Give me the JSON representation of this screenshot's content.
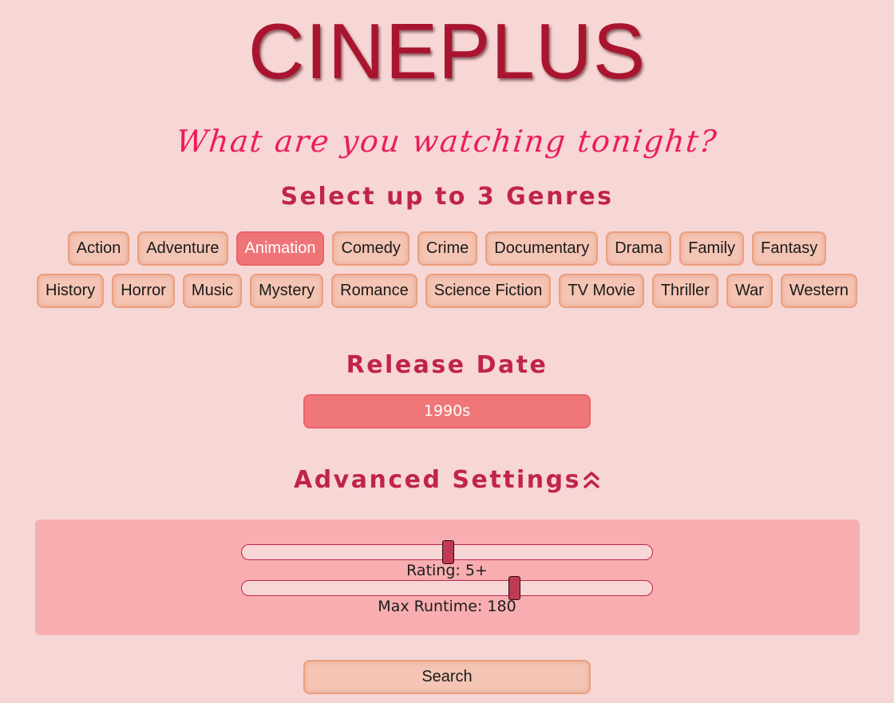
{
  "header": {
    "logo": "CINEPLUS",
    "tagline": "What are you watching tonight?"
  },
  "genres": {
    "heading": "Select up to 3 Genres",
    "row1": [
      {
        "label": "Action",
        "selected": false
      },
      {
        "label": "Adventure",
        "selected": false
      },
      {
        "label": "Animation",
        "selected": true
      },
      {
        "label": "Comedy",
        "selected": false
      },
      {
        "label": "Crime",
        "selected": false
      },
      {
        "label": "Documentary",
        "selected": false
      },
      {
        "label": "Drama",
        "selected": false
      },
      {
        "label": "Family",
        "selected": false
      },
      {
        "label": "Fantasy",
        "selected": false
      }
    ],
    "row2": [
      {
        "label": "History",
        "selected": false
      },
      {
        "label": "Horror",
        "selected": false
      },
      {
        "label": "Music",
        "selected": false
      },
      {
        "label": "Mystery",
        "selected": false
      },
      {
        "label": "Romance",
        "selected": false
      },
      {
        "label": "Science Fiction",
        "selected": false
      },
      {
        "label": "TV Movie",
        "selected": false
      },
      {
        "label": "Thriller",
        "selected": false
      },
      {
        "label": "War",
        "selected": false
      },
      {
        "label": "Western",
        "selected": false
      }
    ]
  },
  "release_date": {
    "heading": "Release Date",
    "selected_value": "1990s"
  },
  "advanced": {
    "heading": "Advanced Settings",
    "toggle_icon": "double-chevron-up-icon",
    "rating": {
      "label": "Rating: 5+",
      "value": 5,
      "min": 0,
      "max": 10
    },
    "runtime": {
      "label": "Max Runtime: 180",
      "value": 180,
      "min": 0,
      "max": 270
    }
  },
  "search": {
    "label": "Search"
  },
  "colors": {
    "background": "#f7d6d6",
    "brand": "#a9142f",
    "accent": "#c0244a",
    "tagline": "#ec1c5e",
    "chip": "#f4c4b4",
    "chip_selected": "#ef7478",
    "panel": "#f8aeb0"
  }
}
